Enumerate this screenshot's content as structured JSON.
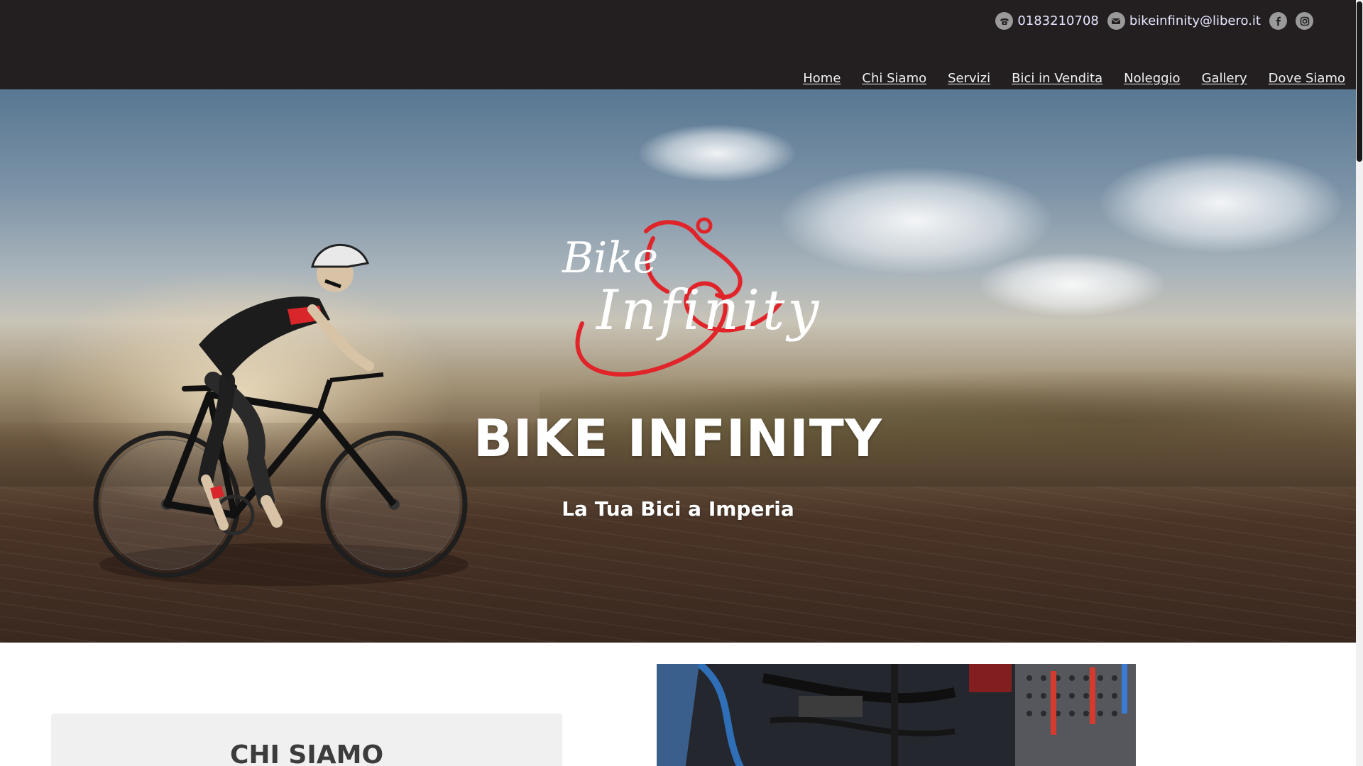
{
  "header": {
    "phone": "0183210708",
    "email": "bikeinfinity@libero.it",
    "social": [
      {
        "name": "facebook-icon"
      },
      {
        "name": "instagram-icon"
      }
    ]
  },
  "nav": {
    "items": [
      "Home",
      "Chi Siamo",
      "Servizi",
      "Bici in Vendita",
      "Noleggio",
      "Gallery",
      "Dove Siamo"
    ]
  },
  "hero": {
    "logo_text_1": "Bike",
    "logo_text_2": "Infinity",
    "title": "BIKE INFINITY",
    "subtitle": "La Tua Bici a Imperia"
  },
  "about": {
    "title": "CHI SIAMO"
  },
  "colors": {
    "header_bg": "#231f20",
    "logo_red": "#e0242a",
    "text_white": "#ffffff",
    "card_bg": "#f0f0f0",
    "card_title": "#3c3c3c"
  }
}
